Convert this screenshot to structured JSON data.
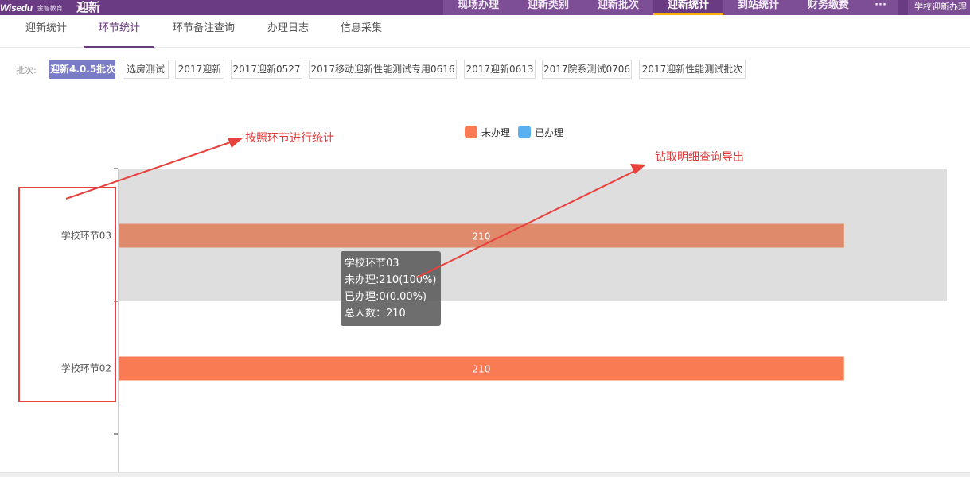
{
  "header": {
    "logo_text": "Wisedu",
    "logo_sub": "金智教育",
    "app_title": "迎新",
    "nav": [
      {
        "label": "现场办理"
      },
      {
        "label": "迎新类别"
      },
      {
        "label": "迎新批次"
      },
      {
        "label": "迎新统计"
      },
      {
        "label": "到站统计"
      },
      {
        "label": "财务缴费"
      },
      {
        "label": "···"
      }
    ],
    "active_nav": 3,
    "school_button": "学校迎新办理"
  },
  "tabs": [
    {
      "label": "迎新统计"
    },
    {
      "label": "环节统计"
    },
    {
      "label": "环节备注查询"
    },
    {
      "label": "办理日志"
    },
    {
      "label": "信息采集"
    }
  ],
  "active_tab": 1,
  "batch_filter": {
    "label": "批次:",
    "options": [
      {
        "label": "迎新4.0.5批次"
      },
      {
        "label": "选房测试"
      },
      {
        "label": "2017迎新"
      },
      {
        "label": "2017迎新0527"
      },
      {
        "label": "2017移动迎新性能测试专用0616"
      },
      {
        "label": "2017迎新0613"
      },
      {
        "label": "2017院系测试0706"
      },
      {
        "label": "2017迎新性能测试批次"
      }
    ],
    "selected": 0
  },
  "chart_data": {
    "type": "bar",
    "orientation": "horizontal",
    "stacked": true,
    "categories": [
      "学校环节03",
      "学校环节02"
    ],
    "series": [
      {
        "name": "未办理",
        "values": [
          210,
          210
        ],
        "color": "#f97b53"
      },
      {
        "name": "已办理",
        "values": [
          0,
          0
        ],
        "color": "#5ab1ef"
      }
    ],
    "data_labels": [
      "210",
      "210"
    ],
    "legend_position": "top-center",
    "highlighted_category": "学校环节03",
    "highlight_bar_color": "#e08a6c"
  },
  "tooltip": {
    "title": "学校环节03",
    "line1": "未办理:210(100%)",
    "line2": "已办理:0(0.00%)",
    "line3": "总人数：210"
  },
  "annotations": {
    "by_step": "按照环节进行统计",
    "drill_export": "钻取明细查询导出",
    "color": "#e8403d"
  }
}
